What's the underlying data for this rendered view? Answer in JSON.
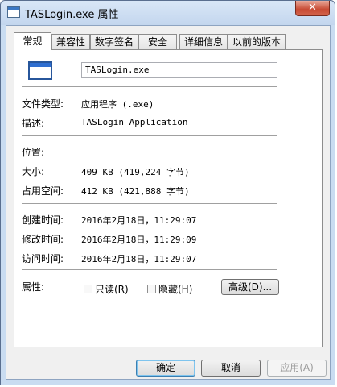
{
  "window": {
    "title": "TASLogin.exe 属性",
    "close_glyph": "✕"
  },
  "tabs": [
    {
      "label": "常规"
    },
    {
      "label": "兼容性"
    },
    {
      "label": "数字签名"
    },
    {
      "label": "安全"
    },
    {
      "label": "详细信息"
    },
    {
      "label": "以前的版本"
    }
  ],
  "file": {
    "name": "TASLogin.exe"
  },
  "info": {
    "type_label": "文件类型:",
    "type_value": "应用程序 (.exe)",
    "desc_label": "描述:",
    "desc_value": "TASLogin Application",
    "location_label": "位置:",
    "size_label": "大小:",
    "size_value": "409 KB (419,224 字节)",
    "disk_label": "占用空间:",
    "disk_value": "412 KB (421,888 字节)",
    "created_label": "创建时间:",
    "created_value": "2016年2月18日，11:29:07",
    "modified_label": "修改时间:",
    "modified_value": "2016年2月18日，11:29:09",
    "accessed_label": "访问时间:",
    "accessed_value": "2016年2月18日，11:29:07"
  },
  "attributes": {
    "label": "属性:",
    "readonly": "只读(R)",
    "hidden": "隐藏(H)",
    "advanced": "高级(D)..."
  },
  "buttons": {
    "ok": "确定",
    "cancel": "取消",
    "apply": "应用(A)"
  }
}
